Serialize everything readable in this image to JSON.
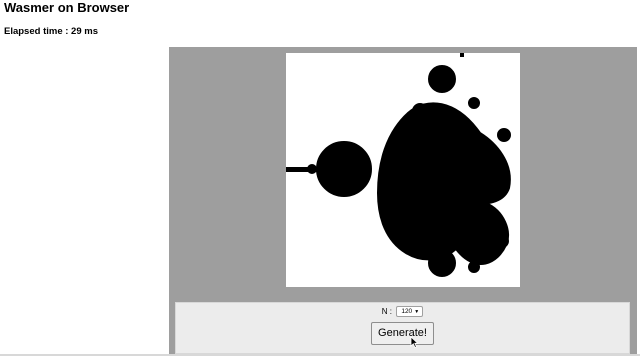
{
  "page": {
    "title": "Wasmer on Browser",
    "elapsed_label": "Elapsed time : 29 ms"
  },
  "render": {
    "background_color": "#9e9e9e",
    "canvas_background": "#ffffff",
    "fractal_color": "#000000"
  },
  "controls": {
    "n_label": "N :",
    "n_selected": "120",
    "generate_label": "Generate!"
  },
  "icons": {
    "cursor": "mouse-pointer-icon",
    "select_arrow": "chevron-down-icon"
  }
}
